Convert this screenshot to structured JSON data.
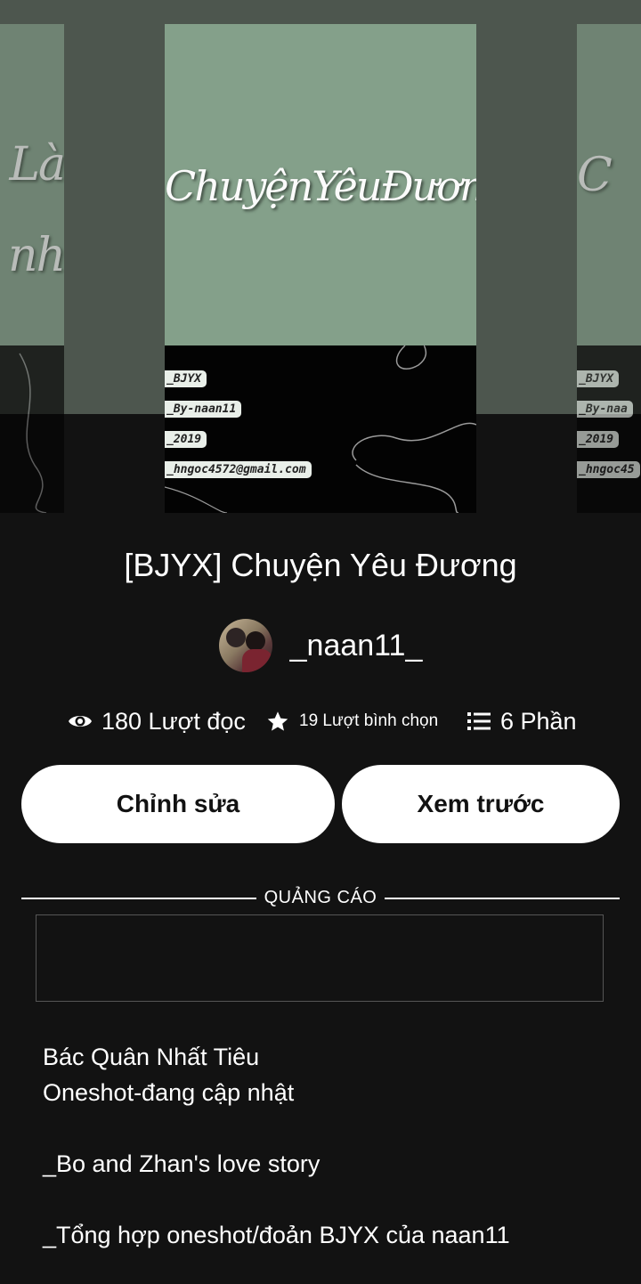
{
  "cover": {
    "main_title": "ChuyệnYêuĐương",
    "tags": [
      "_BJYX",
      "_By-naan11",
      "_2019",
      "_hngoc4572@gmail.com"
    ],
    "left_title_lines": [
      "Là",
      "nh"
    ],
    "left_tags": [],
    "right_title": "C",
    "right_tags": [
      "_BJYX",
      "_By-naa",
      "_2019",
      "_hngoc45"
    ]
  },
  "story": {
    "title": "[BJYX] Chuyện Yêu Đương"
  },
  "author": {
    "name": "_naan11_"
  },
  "stats": {
    "reads": "180 Lượt đọc",
    "votes": "19 Lượt bình chọn",
    "parts": "6 Phần"
  },
  "buttons": {
    "edit": "Chỉnh sửa",
    "preview": "Xem trước"
  },
  "ad": {
    "label": "QUẢNG CÁO"
  },
  "description": {
    "lines": [
      "Bác Quân Nhất Tiêu",
      "Oneshot-đang cập nhật",
      "_Bo and Zhan's love story",
      "_Tổng hợp oneshot/đoản BJYX của naan11"
    ]
  }
}
